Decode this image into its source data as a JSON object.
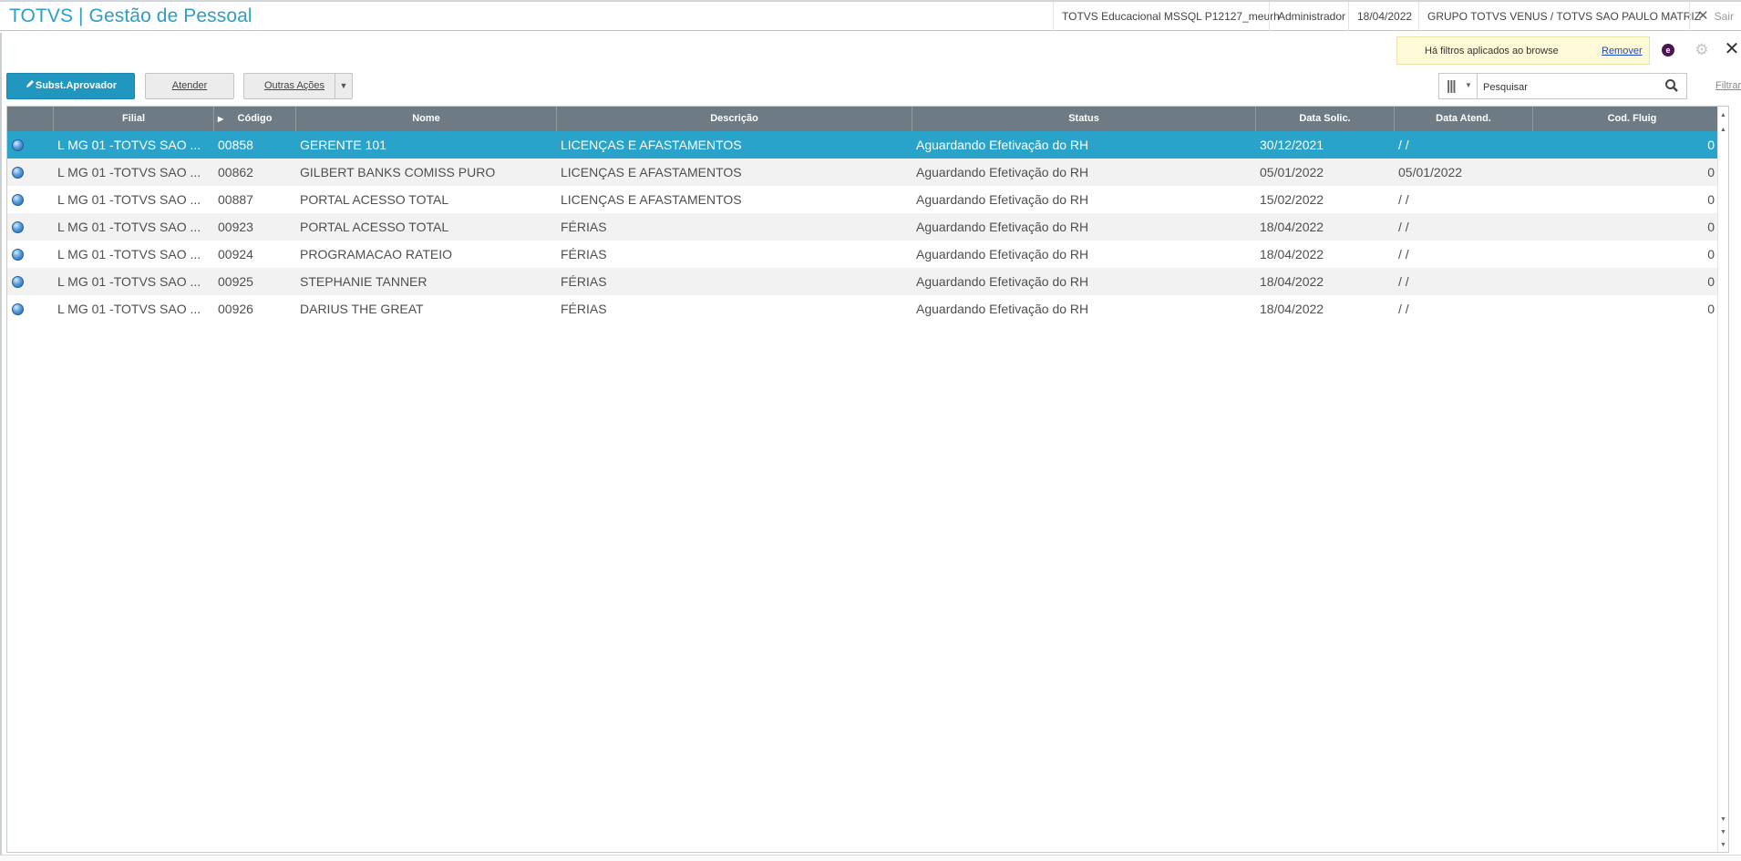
{
  "header": {
    "title": "TOTVS | Gestão de Pessoal",
    "environment": "TOTVS Educacional MSSQL P12127_meurh",
    "user": "Administrador",
    "date": "18/04/2022",
    "company": "GRUPO TOTVS VENUS / TOTVS SAO PAULO MATRIZ",
    "exit_label": "Sair"
  },
  "filter_banner": {
    "text": "Há filtros aplicados ao browse",
    "remove_label": "Remover"
  },
  "toolbar": {
    "primary_label": "Subst.Aprovador",
    "atender_label": "Atender",
    "more_actions_label": "Outras Ações"
  },
  "search": {
    "placeholder": "Pesquisar",
    "filter_link": "Filtrar"
  },
  "grid": {
    "columns": [
      "Filial",
      "Código",
      "Nome",
      "Descrição",
      "Status",
      "Data Solic.",
      "Data Atend.",
      "Cod. Fluig"
    ],
    "rows": [
      {
        "filial": "L MG 01 -TOTVS SAO ...",
        "codigo": "00858",
        "nome": "GERENTE 101",
        "descricao": "LICENÇAS E AFASTAMENTOS",
        "status": "Aguardando Efetivação do RH",
        "data_solic": "30/12/2021",
        "data_atend": "  /  /",
        "cod_fluig": "0",
        "selected": true
      },
      {
        "filial": "L MG 01 -TOTVS SAO ...",
        "codigo": "00862",
        "nome": "GILBERT BANKS COMISS PURO",
        "descricao": "LICENÇAS E AFASTAMENTOS",
        "status": "Aguardando Efetivação do RH",
        "data_solic": "05/01/2022",
        "data_atend": "05/01/2022",
        "cod_fluig": "0",
        "selected": false
      },
      {
        "filial": "L MG 01 -TOTVS SAO ...",
        "codigo": "00887",
        "nome": "PORTAL ACESSO TOTAL",
        "descricao": "LICENÇAS E AFASTAMENTOS",
        "status": "Aguardando Efetivação do RH",
        "data_solic": "15/02/2022",
        "data_atend": "  /  /",
        "cod_fluig": "0",
        "selected": false
      },
      {
        "filial": "L MG 01 -TOTVS SAO ...",
        "codigo": "00923",
        "nome": "PORTAL ACESSO TOTAL",
        "descricao": "FÉRIAS",
        "status": "Aguardando Efetivação do RH",
        "data_solic": "18/04/2022",
        "data_atend": "  /  /",
        "cod_fluig": "0",
        "selected": false
      },
      {
        "filial": "L MG 01 -TOTVS SAO ...",
        "codigo": "00924",
        "nome": "PROGRAMACAO RATEIO",
        "descricao": "FÉRIAS",
        "status": "Aguardando Efetivação do RH",
        "data_solic": "18/04/2022",
        "data_atend": "  /  /",
        "cod_fluig": "0",
        "selected": false
      },
      {
        "filial": "L MG 01 -TOTVS SAO ...",
        "codigo": "00925",
        "nome": "STEPHANIE TANNER",
        "descricao": "FÉRIAS",
        "status": "Aguardando Efetivação do RH",
        "data_solic": "18/04/2022",
        "data_atend": "  /  /",
        "cod_fluig": "0",
        "selected": false
      },
      {
        "filial": "L MG 01 -TOTVS SAO ...",
        "codigo": "00926",
        "nome": "DARIUS THE GREAT",
        "descricao": "FÉRIAS",
        "status": "Aguardando Efetivação do RH",
        "data_solic": "18/04/2022",
        "data_atend": "  /  /",
        "cod_fluig": "0",
        "selected": false
      }
    ]
  },
  "colors": {
    "accent": "#2aa3cb",
    "primary_button": "#2197bf",
    "grid_header": "#6e7b84",
    "banner_bg": "#fffbd8"
  },
  "icons": {
    "legend": "legend-dot-icon",
    "search": "search-icon",
    "settings": "gear-icon",
    "close": "close-icon",
    "edit": "pencil-icon"
  }
}
